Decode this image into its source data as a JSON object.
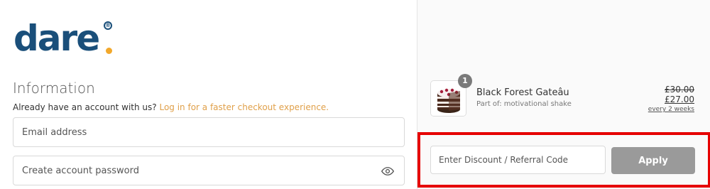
{
  "brand": {
    "logo_text": "dare",
    "logo_registered": "®",
    "logo_dot_color": "#f2a82b",
    "logo_color": "#1a4f7a"
  },
  "information": {
    "title": "Information",
    "account_prompt": "Already have an account with us?",
    "login_link": "Log in for a faster checkout experience.",
    "email_placeholder": "Email address",
    "password_placeholder": "Create account password",
    "password_icon": "eye-icon"
  },
  "order_summary": {
    "product": {
      "name": "Black Forest Gateâu",
      "subtitle": "Part of: motivational shake",
      "quantity": "1",
      "price_original": "£30.00",
      "price_current": "£27.00",
      "frequency": "every 2 weeks"
    },
    "discount": {
      "placeholder": "Enter Discount / Referral Code",
      "apply_label": "Apply"
    }
  },
  "colors": {
    "link": "#e0a04a",
    "apply_button": "#9a9a9a",
    "highlight_border": "#e60000"
  }
}
